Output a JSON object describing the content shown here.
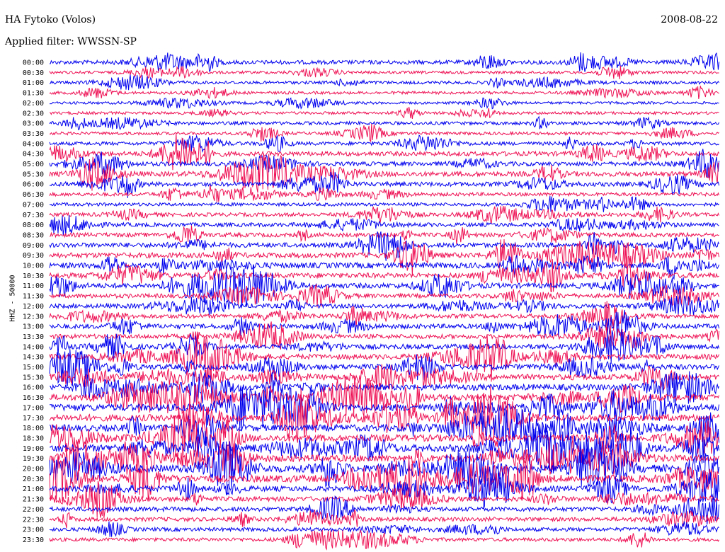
{
  "header": {
    "station": "HA Fytoko (Volos)",
    "filter": "Applied filter: WWSSN-SP",
    "date": "2008-08-22"
  },
  "chart_data": {
    "type": "line",
    "subtype": "helicorder",
    "title": "HA Fytoko (Volos)",
    "ylabel": "HHZ - 50000",
    "rows": [
      "00:00",
      "00:30",
      "01:00",
      "01:30",
      "02:00",
      "02:30",
      "03:00",
      "03:30",
      "04:00",
      "04:30",
      "05:00",
      "05:30",
      "06:00",
      "06:30",
      "07:00",
      "07:30",
      "08:00",
      "08:30",
      "09:00",
      "09:30",
      "10:00",
      "10:30",
      "11:00",
      "11:30",
      "12:00",
      "12:30",
      "13:00",
      "13:30",
      "14:00",
      "14:30",
      "15:00",
      "15:30",
      "16:00",
      "16:30",
      "17:00",
      "17:30",
      "18:00",
      "18:30",
      "19:00",
      "19:30",
      "20:00",
      "20:30",
      "21:00",
      "21:30",
      "22:00",
      "22:30",
      "23:00",
      "23:30"
    ],
    "row_minutes": 30,
    "colors": [
      "#0000ee",
      "#ee1155"
    ],
    "activity": [
      1.0,
      0.5,
      0.6,
      0.5,
      0.4,
      0.5,
      0.7,
      0.6,
      0.8,
      1.2,
      1.1,
      1.4,
      1.2,
      0.8,
      0.7,
      0.9,
      1.0,
      1.1,
      1.3,
      1.5,
      1.7,
      1.5,
      1.5,
      1.1,
      1.2,
      1.1,
      1.3,
      1.2,
      1.4,
      1.5,
      1.6,
      1.7,
      1.9,
      2.0,
      2.3,
      2.2,
      2.1,
      2.2,
      2.4,
      2.3,
      2.5,
      2.4,
      1.6,
      1.3,
      1.2,
      1.0,
      0.9,
      0.8
    ],
    "grid": false,
    "legend": "none"
  }
}
